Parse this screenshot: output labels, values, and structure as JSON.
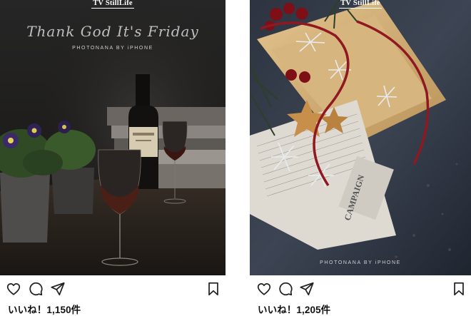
{
  "posts": [
    {
      "watermark": "TV StillLife",
      "script_text": "Thank God It's Friday",
      "credit": "PHOTONANA BY iPHONE",
      "likes": "いいね！1,150件"
    },
    {
      "watermark": "TV StillLife",
      "credit": "PHOTONANA BY iPHONE",
      "likes": "いいね！1,205件"
    }
  ],
  "icons": [
    "heart-icon",
    "comment-icon",
    "share-icon",
    "bookmark-icon"
  ],
  "colors": {
    "text": "#111111",
    "icon_stroke": "#222222",
    "background": "#ffffff"
  }
}
